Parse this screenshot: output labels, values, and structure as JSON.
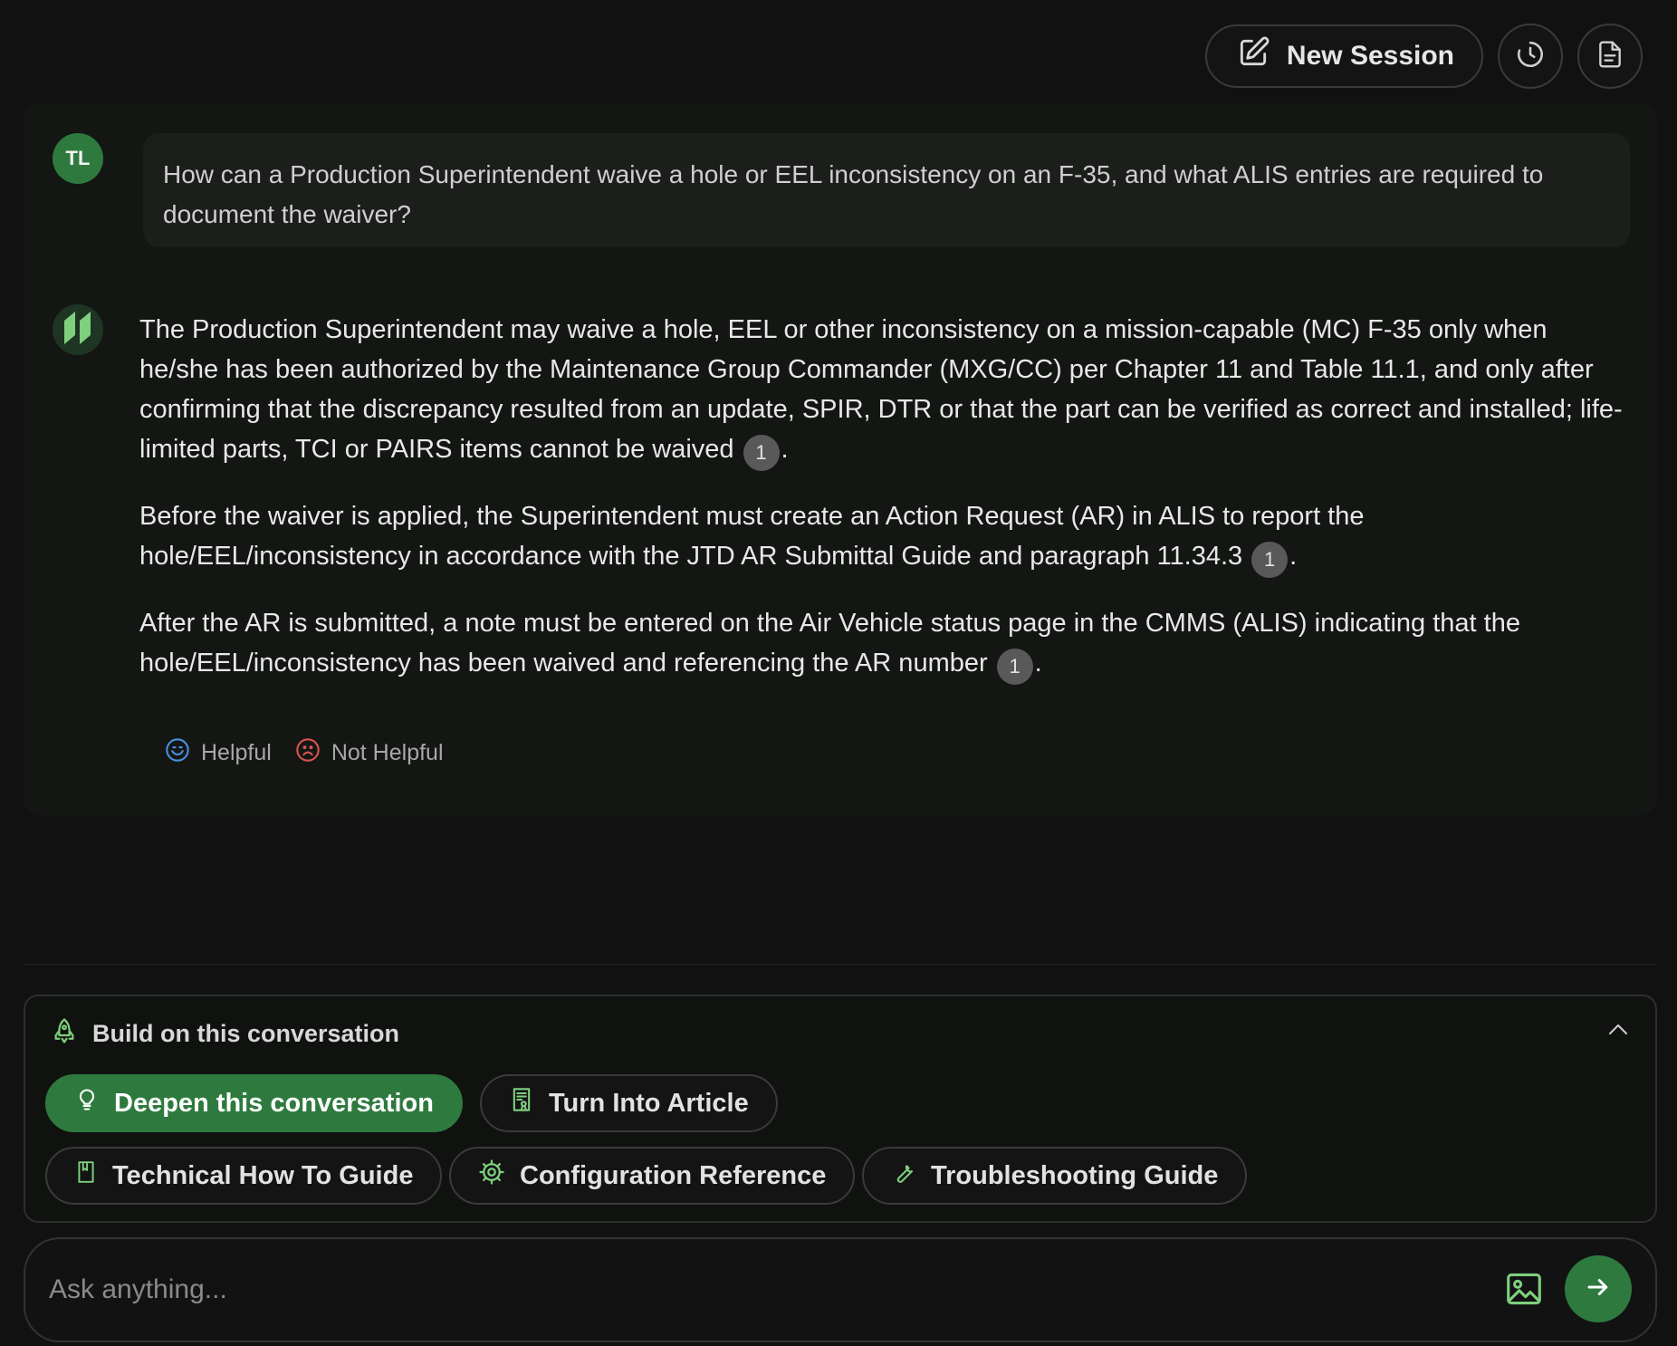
{
  "toolbar": {
    "new_session_label": "New Session",
    "history_icon": "history-icon",
    "document_icon": "document-icon"
  },
  "conversation": {
    "user_initials": "TL",
    "user_question": "How can a Production Superintendent waive a hole or EEL inconsistency on an F-35, and what ALIS entries are required to document the waiver?",
    "answer_paragraphs": [
      {
        "text": "The Production Superintendent may waive a hole, EEL or other inconsistency on a mission-capable (MC) F-35 only when he/she has been authorized by the Maintenance Group Commander (MXG/CC) per Chapter 11 and Table 11.1, and only after confirming that the discrepancy resulted from an update, SPIR, DTR or that the part can be verified as correct and installed; life-limited parts, TCI or PAIRS items cannot be waived",
        "citation": "1"
      },
      {
        "text": "Before the waiver is applied, the Superintendent must create an Action Request (AR) in ALIS to report the hole/EEL/inconsistency in accordance with the JTD AR Submittal Guide and paragraph 11.34.3",
        "citation": "1"
      },
      {
        "text": "After the AR is submitted, a note must be entered on the Air Vehicle status page in the CMMS (ALIS) indicating that the hole/EEL/inconsistency has been waived and referencing the AR number",
        "citation": "1"
      }
    ],
    "feedback": {
      "helpful_label": "Helpful",
      "not_helpful_label": "Not Helpful"
    }
  },
  "build_panel": {
    "title": "Build on this conversation",
    "chips": [
      {
        "label": "Deepen this conversation",
        "icon": "lightbulb-icon"
      },
      {
        "label": "Turn Into Article",
        "icon": "article-icon"
      },
      {
        "label": "Technical How To Guide",
        "icon": "book-icon"
      },
      {
        "label": "Configuration Reference",
        "icon": "gear-icon"
      },
      {
        "label": "Troubleshooting Guide",
        "icon": "wrench-icon"
      }
    ]
  },
  "input": {
    "placeholder": "Ask anything..."
  },
  "colors": {
    "accent": "#2e7a3e",
    "background": "#111111",
    "panel": "#131613"
  }
}
